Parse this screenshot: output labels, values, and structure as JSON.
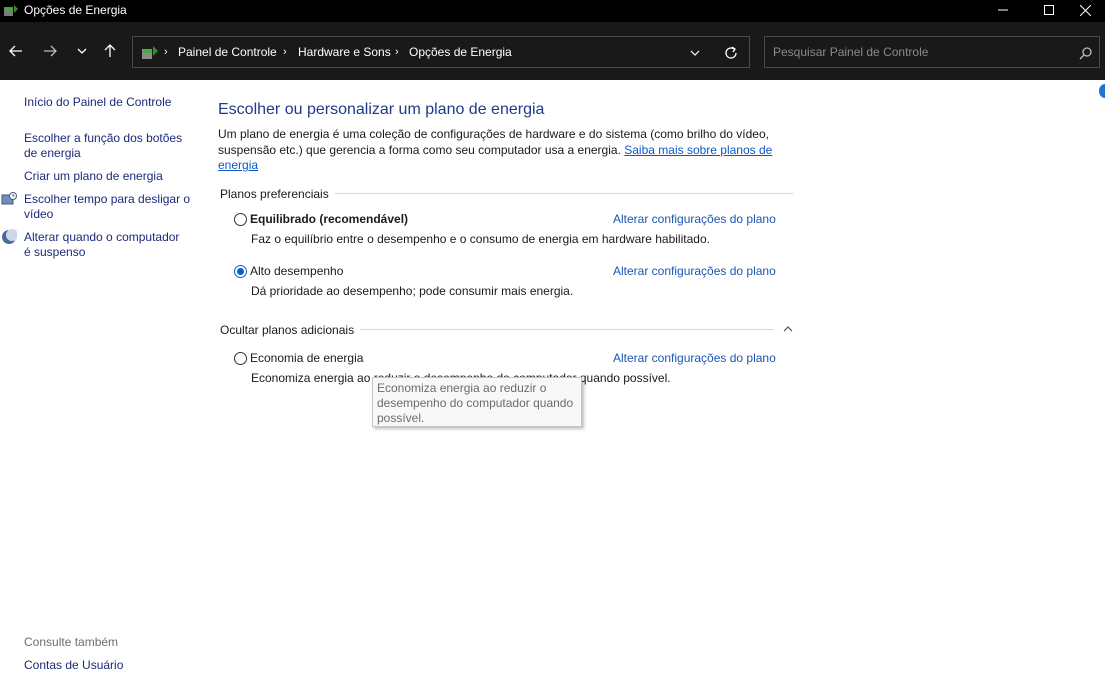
{
  "window": {
    "title": "Opções de Energia"
  },
  "navigation": {
    "breadcrumbs": [
      "Painel de Controle",
      "Hardware e Sons",
      "Opções de Energia"
    ],
    "search_placeholder": "Pesquisar Painel de Controle"
  },
  "sidebar": {
    "home": "Início do Painel de Controle",
    "links": [
      {
        "line1": "Escolher a função dos botões",
        "line2": "de energia"
      },
      {
        "line1": "Criar um plano de energia",
        "line2": ""
      },
      {
        "line1": "Escolher tempo para desligar o",
        "line2": "vídeo"
      },
      {
        "line1": "Alterar quando o computador",
        "line2": "é suspenso"
      }
    ],
    "see_also": "Consulte também",
    "user_accounts": "Contas de Usuário"
  },
  "main": {
    "heading": "Escolher ou personalizar um plano de energia",
    "intro": "Um plano de energia é uma coleção de configurações de hardware e do sistema (como brilho do vídeo, suspensão etc.) que gerencia a forma como seu computador usa a energia.",
    "learn_more": "Saiba mais sobre planos de energia",
    "preferred_label": "Planos preferenciais",
    "additional_label": "Ocultar planos adicionais",
    "plans": [
      {
        "name": "Equilibrado (recomendável)",
        "description": "Faz o equilíbrio entre o desempenho e o consumo de energia em hardware habilitado.",
        "selected": false,
        "link": "Alterar configurações do plano"
      },
      {
        "name": "Alto desempenho",
        "description": "Dá prioridade ao desempenho; pode consumir mais energia.",
        "selected": true,
        "link": "Alterar configurações do plano"
      },
      {
        "name": "Economia de energia",
        "description": "Economiza energia ao reduzir o desempenho do computador quando possível.",
        "selected": false,
        "link": "Alterar configurações do plano"
      }
    ]
  },
  "tooltip": {
    "lines": [
      "Economiza energia ao reduzir o",
      "desempenho do computador quando",
      "possível."
    ]
  },
  "colors": {
    "link": "#1b56b5",
    "heading": "#1e3a8a",
    "titlebar": "#000000",
    "navbar": "#191919",
    "radio_selected": "#0b61c4"
  }
}
